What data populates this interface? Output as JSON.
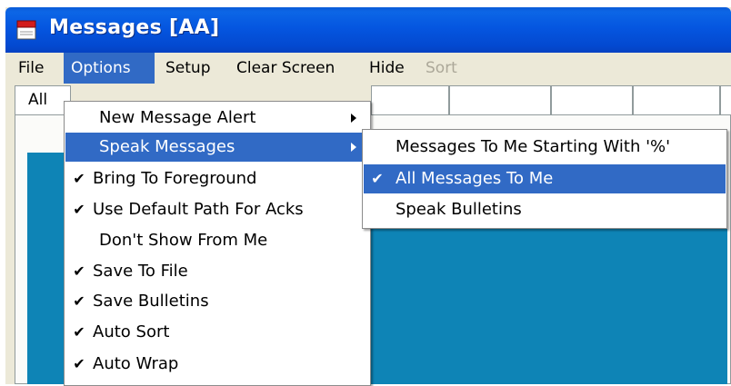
{
  "window": {
    "title": "Messages  [AA]",
    "icon": "notepad-red-icon"
  },
  "menubar": {
    "items": [
      {
        "label": "File",
        "state": "normal"
      },
      {
        "label": "Options",
        "state": "active"
      },
      {
        "label": "Setup",
        "state": "normal"
      },
      {
        "label": "Clear Screen",
        "state": "normal"
      },
      {
        "label": "Hide",
        "state": "normal"
      },
      {
        "label": "Sort",
        "state": "disabled"
      }
    ]
  },
  "tabs": {
    "first_label": "All"
  },
  "options_menu": {
    "items": [
      {
        "label": "New Message Alert",
        "checked": false,
        "submenu": true
      },
      {
        "label": "Speak Messages",
        "checked": false,
        "submenu": true,
        "highlighted": true
      },
      {
        "label": "Bring To Foreground",
        "checked": true
      },
      {
        "label": "Use Default Path For Acks",
        "checked": true
      },
      {
        "label": "Don't Show From Me",
        "checked": false
      },
      {
        "label": "Save To File",
        "checked": true
      },
      {
        "label": "Save Bulletins",
        "checked": true
      },
      {
        "label": "Auto Sort",
        "checked": true
      },
      {
        "label": "Auto Wrap",
        "checked": true
      }
    ]
  },
  "speak_submenu": {
    "items": [
      {
        "label": "Messages To Me Starting With '%'",
        "checked": false
      },
      {
        "label": "All Messages To Me",
        "checked": true,
        "highlighted": true
      },
      {
        "label": "Speak Bulletins",
        "checked": false
      }
    ]
  },
  "glyphs": {
    "check": "✔"
  },
  "colors": {
    "titlebar": "#0556e0",
    "highlight": "#316ac5",
    "client_blue": "#0e84b6",
    "menubar": "#ece9d8"
  }
}
